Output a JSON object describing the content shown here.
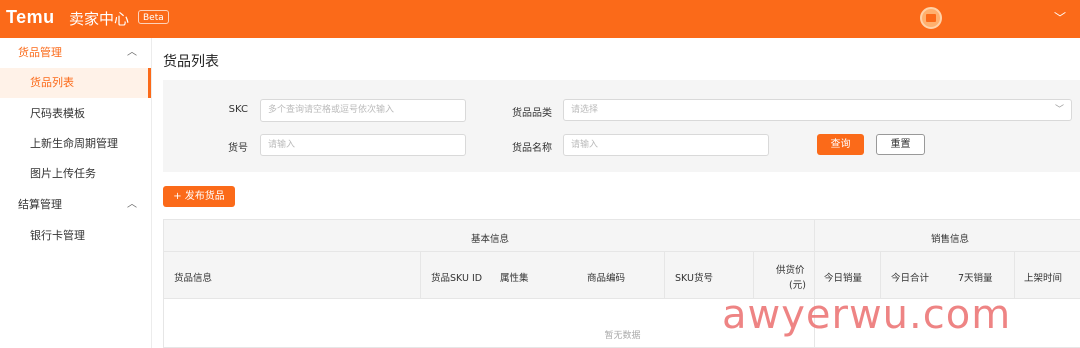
{
  "header": {
    "logo": "Temu",
    "brand": "卖家中心",
    "badge": "Beta",
    "account_name": "",
    "menu_icon": "chevron-down-icon",
    "background": "#fb6a19"
  },
  "sidebar": {
    "groups": [
      {
        "label": "货品管理",
        "expanded": true,
        "items": [
          {
            "label": "货品列表",
            "active": true
          },
          {
            "label": "尺码表模板"
          },
          {
            "label": "上新生命周期管理"
          },
          {
            "label": "图片上传任务"
          }
        ]
      },
      {
        "label": "结算管理",
        "expanded": true,
        "items": [
          {
            "label": "银行卡管理"
          }
        ]
      }
    ]
  },
  "main": {
    "title": "货品列表",
    "filters": {
      "skc": {
        "label": "SKC",
        "placeholder": "多个查询请空格或逗号依次输入"
      },
      "category": {
        "label": "货品品类",
        "placeholder": "请选择"
      },
      "item_no": {
        "label": "货号",
        "placeholder": "请输入"
      },
      "name": {
        "label": "货品名称",
        "placeholder": "请输入"
      },
      "query_button": "查询",
      "reset_button": "重置"
    },
    "publish_button": "+ 发布货品",
    "table": {
      "group_headers": [
        "基本信息",
        "销售信息"
      ],
      "columns": [
        "货品信息",
        "货品SKU ID",
        "属性集",
        "商品编码",
        "SKU货号",
        "供货价",
        "(元)",
        "今日销量",
        "今日合计",
        "7天销量",
        "上架时间"
      ],
      "empty_text": "暂无数据"
    }
  },
  "watermark": "awyerwu.com",
  "colors": {
    "accent": "#fb6a19",
    "active_bg": "#fff2e8",
    "filter_bg": "#f5f5f5"
  }
}
